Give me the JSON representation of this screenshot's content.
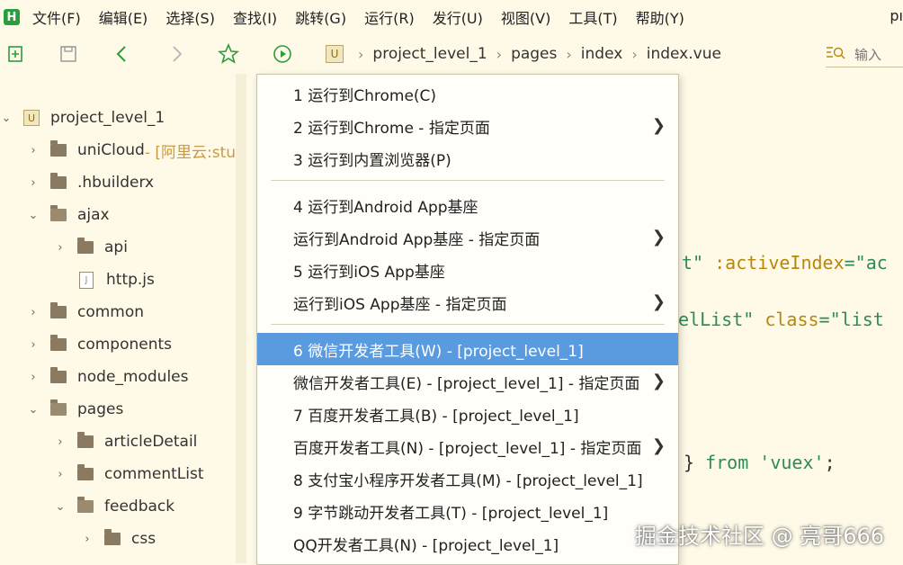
{
  "app": {
    "logo_text": "H"
  },
  "menubar": {
    "items": [
      "文件(F)",
      "编辑(E)",
      "选择(S)",
      "查找(I)",
      "跳转(G)",
      "运行(R)",
      "发行(U)",
      "视图(V)",
      "工具(T)",
      "帮助(Y)"
    ],
    "right_stub": "pı"
  },
  "toolbar": {
    "icons": [
      "new-file-icon",
      "save-icon",
      "back-icon",
      "forward-icon",
      "star-icon",
      "run-icon"
    ]
  },
  "breadcrumb": {
    "home_icon_text": "U",
    "items": [
      "project_level_1",
      "pages",
      "index",
      "index.vue"
    ]
  },
  "search": {
    "placeholder": "输入"
  },
  "sidebar": {
    "tree": [
      {
        "label": "project_level_1",
        "type": "project",
        "chevron": "open",
        "indent": 0
      },
      {
        "label": "uniCloud",
        "note": " - [阿里云:stu",
        "type": "cloud",
        "chevron": "closed",
        "indent": 1
      },
      {
        "label": ".hbuilderx",
        "type": "folder",
        "chevron": "closed",
        "indent": 1
      },
      {
        "label": "ajax",
        "type": "folder-open",
        "chevron": "open",
        "indent": 1
      },
      {
        "label": "api",
        "type": "folder",
        "chevron": "closed",
        "indent": 2
      },
      {
        "label": "http.js",
        "type": "file",
        "chevron": "none",
        "indent": 2
      },
      {
        "label": "common",
        "type": "folder",
        "chevron": "closed",
        "indent": 1
      },
      {
        "label": "components",
        "type": "folder",
        "chevron": "closed",
        "indent": 1
      },
      {
        "label": "node_modules",
        "type": "folder",
        "chevron": "closed",
        "indent": 1
      },
      {
        "label": "pages",
        "type": "folder-open",
        "chevron": "open",
        "indent": 1
      },
      {
        "label": "articleDetail",
        "type": "folder",
        "chevron": "closed",
        "indent": 2
      },
      {
        "label": "commentList",
        "type": "folder",
        "chevron": "closed",
        "indent": 2
      },
      {
        "label": "feedback",
        "type": "folder-open",
        "chevron": "open",
        "indent": 2
      },
      {
        "label": "css",
        "type": "folder",
        "chevron": "closed",
        "indent": 3
      }
    ]
  },
  "editor": {
    "line1": {
      "a": "t\"",
      "b": " :activeIndex",
      "c": "=\"ac"
    },
    "line2": {
      "a": "elList\"",
      "b": " class",
      "c": "=\"list"
    },
    "line3": {
      "a": "} ",
      "b": "from",
      "c": " 'vuex'",
      "d": ";"
    }
  },
  "context_menu": {
    "items": [
      {
        "label": "1 运行到Chrome(C)",
        "submenu": false
      },
      {
        "label": "2 运行到Chrome - 指定页面",
        "submenu": true
      },
      {
        "label": "3 运行到内置浏览器(P)",
        "submenu": false
      },
      {
        "label": "4 运行到Android App基座",
        "submenu": false
      },
      {
        "label": "运行到Android App基座 - 指定页面",
        "submenu": true
      },
      {
        "label": "5 运行到iOS App基座",
        "submenu": false
      },
      {
        "label": "运行到iOS App基座 - 指定页面",
        "submenu": true
      },
      {
        "label": "6 微信开发者工具(W) - [project_level_1]",
        "submenu": false,
        "active": true
      },
      {
        "label": "微信开发者工具(E) - [project_level_1] - 指定页面",
        "submenu": true
      },
      {
        "label": "7 百度开发者工具(B) - [project_level_1]",
        "submenu": false
      },
      {
        "label": "百度开发者工具(N) - [project_level_1] - 指定页面",
        "submenu": true
      },
      {
        "label": "8 支付宝小程序开发者工具(M) - [project_level_1]",
        "submenu": false
      },
      {
        "label": "9 字节跳动开发者工具(T) - [project_level_1]",
        "submenu": false
      },
      {
        "label": "QQ开发者工具(N) - [project_level_1]",
        "submenu": false
      }
    ],
    "submenu_arrow": "❯"
  },
  "watermark": "掘金技术社区 @ 亮哥666",
  "colors": {
    "accent": "#5a9be0",
    "background": "#fffae8",
    "logo": "#2a9d3c"
  }
}
